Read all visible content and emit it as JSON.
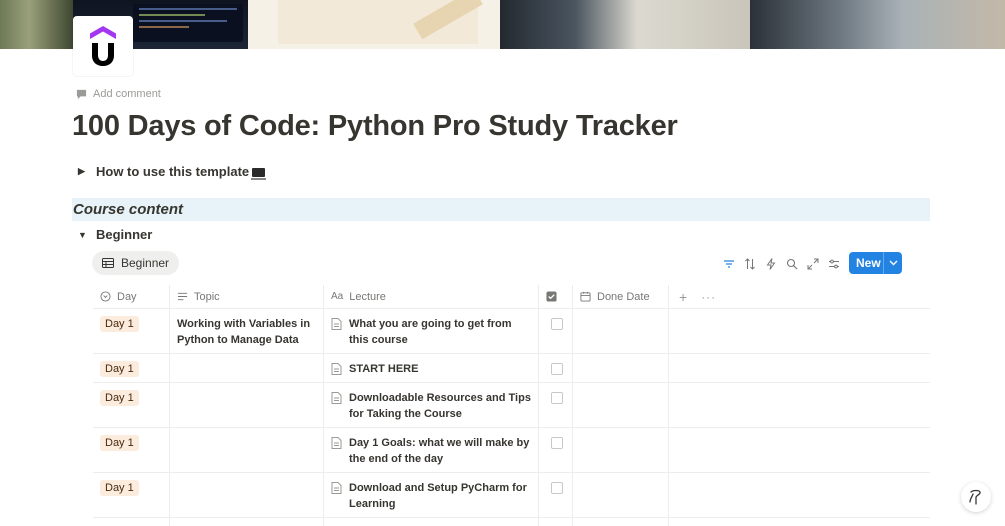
{
  "page": {
    "add_comment": "Add comment",
    "title": "100 Days of Code: Python Pro Study Tracker",
    "logo_icon": "udemy-logo",
    "accent": "#a435f0"
  },
  "toggles": {
    "howto": "How to use this template",
    "beginner": "Beginner"
  },
  "section": {
    "heading": "Course content",
    "background": "#e7f3f8"
  },
  "database": {
    "view_tab": "Beginner",
    "new_button": "New",
    "new_button_color": "#2383e2",
    "toolbar_icons": [
      "filter-icon",
      "sort-icon",
      "automation-icon",
      "search-icon",
      "expand-icon",
      "settings-icon"
    ],
    "columns": {
      "day": "Day",
      "topic": "Topic",
      "lecture": "Lecture",
      "done_date": "Done Date"
    },
    "tag_color": "#fbecdd",
    "rows": [
      {
        "day": "Day 1",
        "topic": "Working with Variables in Python to Manage Data",
        "lecture": "What you are going to get from this course"
      },
      {
        "day": "Day 1",
        "topic": "",
        "lecture": "START HERE"
      },
      {
        "day": "Day 1",
        "topic": "",
        "lecture": "Downloadable Resources and Tips for Taking the Course"
      },
      {
        "day": "Day 1",
        "topic": "",
        "lecture": "Day 1 Goals: what we will make by the end of the day"
      },
      {
        "day": "Day 1",
        "topic": "",
        "lecture": "Download and Setup PyCharm for Learning"
      }
    ]
  },
  "help_button": "?"
}
